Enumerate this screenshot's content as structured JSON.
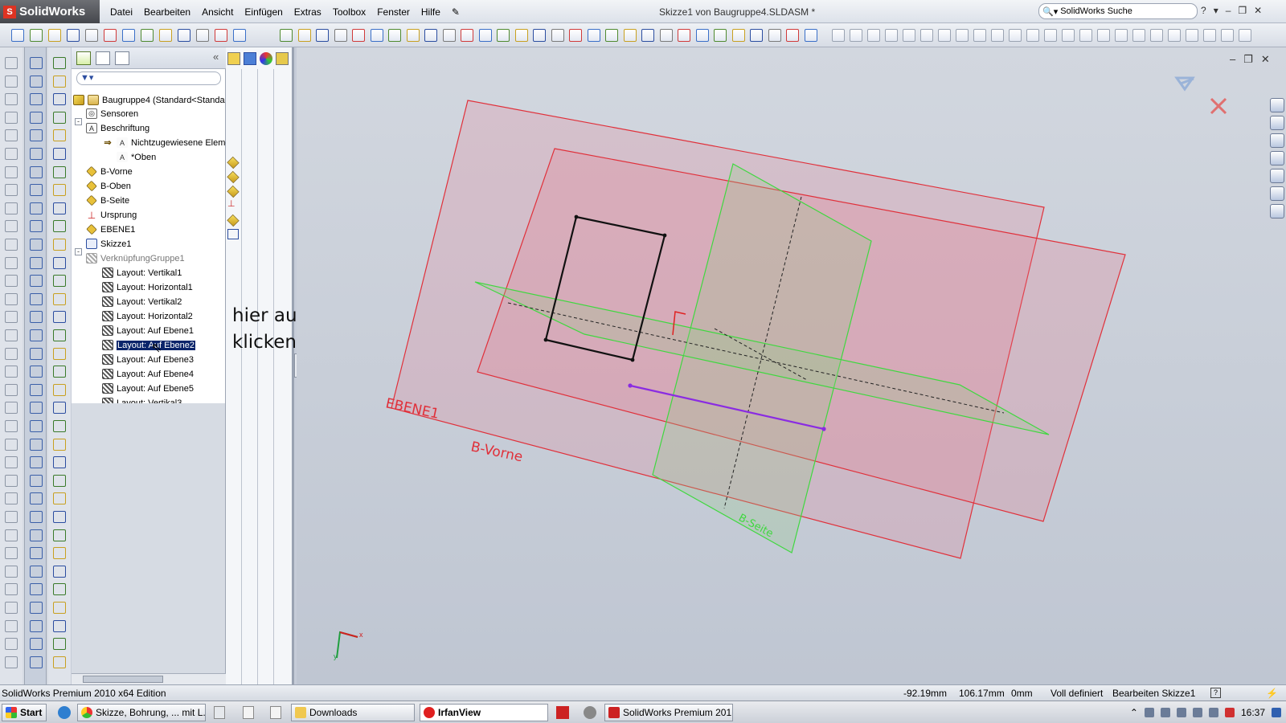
{
  "app": {
    "logo_text": "SolidWorks",
    "window_title": "Skizze1 von Baugruppe4.SLDASM *",
    "search_label": "SolidWorks Suche"
  },
  "menu": [
    "Datei",
    "Bearbeiten",
    "Ansicht",
    "Einfügen",
    "Extras",
    "Toolbox",
    "Fenster",
    "Hilfe"
  ],
  "tree": {
    "root": "Baugruppe4  (Standard<Standa",
    "items": [
      "Sensoren",
      "Beschriftung",
      "Nichtzugewiesene Eleme",
      "*Oben",
      "B-Vorne",
      "B-Oben",
      "B-Seite",
      "Ursprung",
      "EBENE1",
      "Skizze1",
      "VerknüpfungGruppe1",
      "Layout: Vertikal1",
      "Layout: Horizontal1",
      "Layout: Vertikal2",
      "Layout: Horizontal2",
      "Layout: Auf Ebene1",
      "Layout: Auf Ebene2",
      "Layout: Auf Ebene3",
      "Layout: Auf Ebene4",
      "Layout: Auf Ebene5",
      "Layout: Vertikal3"
    ]
  },
  "annotation": {
    "line1": "hier auf die Verknüpfung",
    "line2": "klicken"
  },
  "viewport": {
    "plane_labels": [
      "EBENE1",
      "B-Vorne",
      "B-Seite"
    ],
    "colors": {
      "plane_red": "#e0303a",
      "plane_green": "#3fd83f",
      "sketch_line": "#8a2be2"
    }
  },
  "status": {
    "edition": "SolidWorks Premium 2010 x64 Edition",
    "coord_x": "-92.19mm",
    "coord_y": "106.17mm",
    "coord_z": "0mm",
    "state": "Voll definiert",
    "mode": "Bearbeiten Skizze1"
  },
  "taskbar": {
    "start": "Start",
    "buttons": [
      "Skizze, Bohrung, ... mit L...",
      "Downloads",
      "IrfanView",
      "SolidWorks Premium 201..."
    ],
    "clock": "16:37"
  }
}
